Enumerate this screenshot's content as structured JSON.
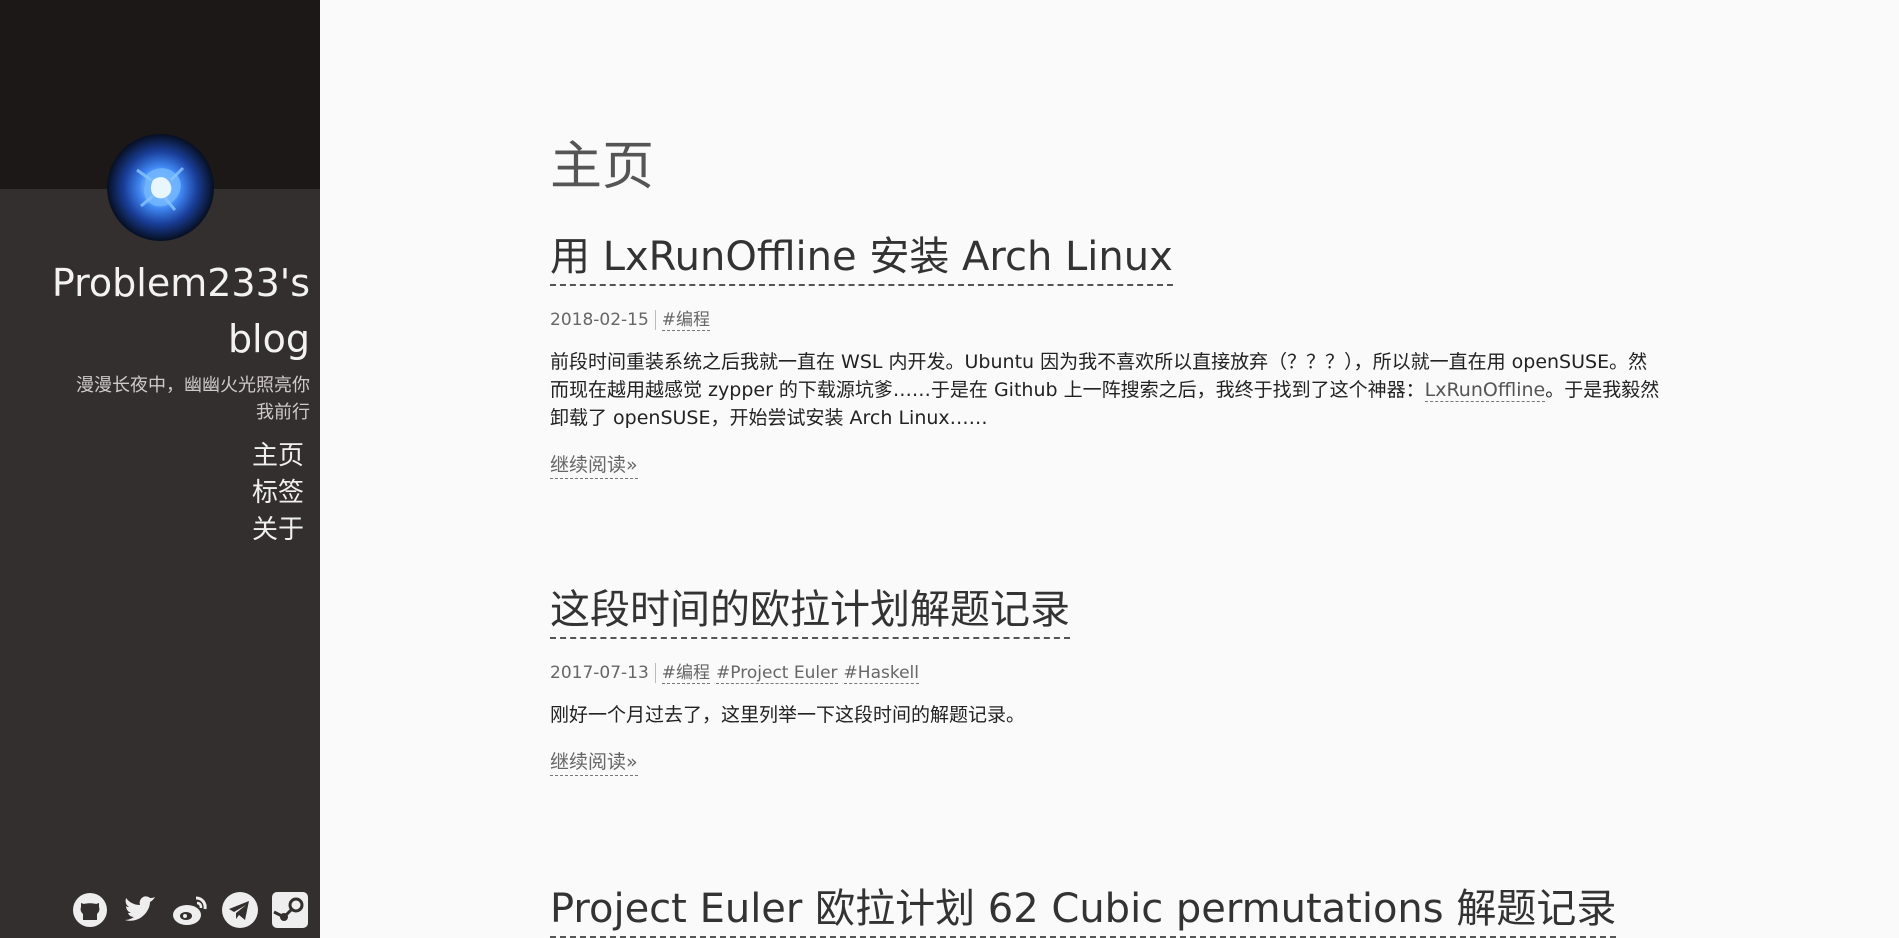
{
  "sidebar": {
    "title": "Problem233's blog",
    "subtitle": "漫漫长夜中，幽幽火光照亮你我前行",
    "nav": [
      "主页",
      "标签",
      "关于"
    ],
    "social_icons": [
      "github-icon",
      "twitter-icon",
      "weibo-icon",
      "telegram-icon",
      "steam-icon"
    ]
  },
  "main": {
    "page_title": "主页",
    "posts": [
      {
        "title": "用 LxRunOffline 安装 Arch Linux",
        "date": "2018-02-15",
        "tags": [
          "#编程"
        ],
        "excerpt_before_link": "前段时间重装系统之后我就一直在 WSL 内开发。Ubuntu 因为我不喜欢所以直接放弃（？？？），所以就一直在用 openSUSE。然而现在越用越感觉 zypper 的下载源坑爹……于是在 Github 上一阵搜索之后，我终于找到了这个神器：",
        "excerpt_link": "LxRunOffline",
        "excerpt_after_link": "。于是我毅然卸载了 openSUSE，开始尝试安装 Arch Linux……",
        "read_more": "继续阅读»"
      },
      {
        "title": "这段时间的欧拉计划解题记录",
        "date": "2017-07-13",
        "tags": [
          "#编程",
          "#Project Euler",
          "#Haskell"
        ],
        "excerpt": "刚好一个月过去了，这里列举一下这段时间的解题记录。",
        "read_more": "继续阅读»"
      },
      {
        "title": "Project Euler 欧拉计划 62 Cubic permutations 解题记录"
      }
    ]
  },
  "colors": {
    "sidebar_bg": "#332f2e",
    "sidebar_top_bg": "#1c1817",
    "main_bg": "#fafafa"
  }
}
